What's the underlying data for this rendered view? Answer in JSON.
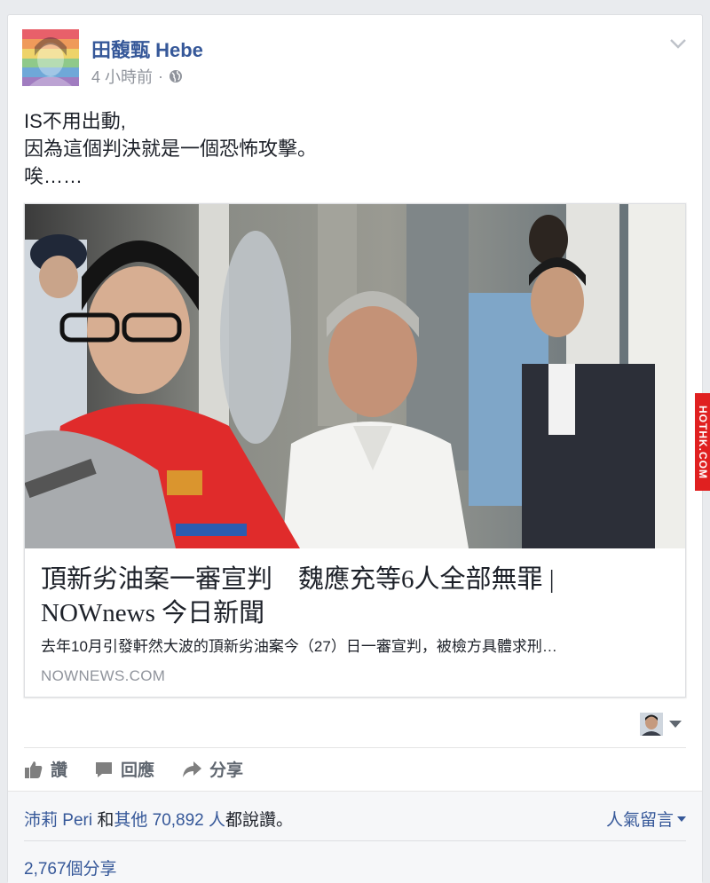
{
  "post": {
    "author": "田馥甄 Hebe",
    "time": "4 小時前",
    "separator": "·",
    "text_lines": [
      "IS不用出動,",
      "因為這個判決就是一個恐怖攻擊。",
      "唉……"
    ]
  },
  "link": {
    "title": "頂新劣油案一審宣判　魏應充等6人全部無罪 | NOWnews 今日新聞",
    "description": "去年10月引發軒然大波的頂新劣油案今（27）日一審宣判，被檢方具體求刑…",
    "domain": "NOWNEWS.COM",
    "watermark": "HOTHK.COM"
  },
  "actions": {
    "like": "讚",
    "comment": "回應",
    "share": "分享"
  },
  "footer": {
    "liker_name": "沛莉 Peri",
    "and_text": " 和",
    "others_link": "其他 70,892 人",
    "suffix": "都說讚。",
    "top_comments": "人氣留言",
    "shares": "2,767個分享"
  },
  "colors": {
    "link_blue": "#365899",
    "secondary_gray": "#90949c",
    "background": "#e9ebee",
    "footer_bg": "#f6f7f9"
  },
  "icons": {
    "globe": "globe-icon",
    "chevron": "chevron-down-icon",
    "like": "thumbs-up-icon",
    "comment": "speech-bubble-icon",
    "share": "share-arrow-icon"
  }
}
